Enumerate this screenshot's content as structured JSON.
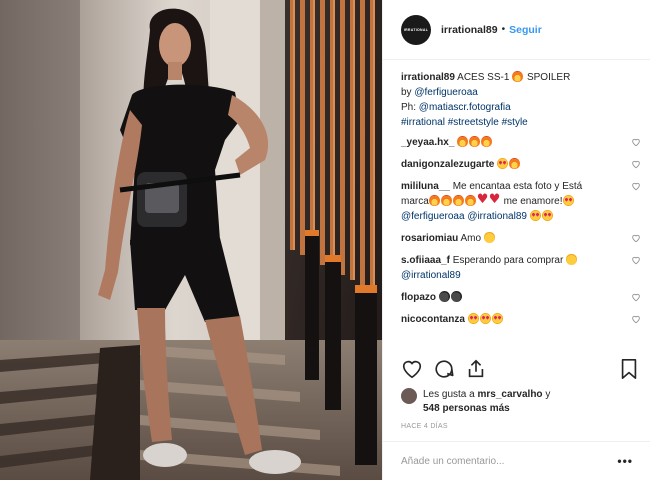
{
  "header": {
    "avatar_text": "IRRATIONAL",
    "username": "irrational89",
    "separator": "•",
    "follow_label": "Seguir"
  },
  "caption": {
    "username": "irrational89",
    "text1": "ACES SS-1",
    "text2": "SPOILER",
    "by_prefix": "by",
    "by_mention": "@ferfigueroaa",
    "ph_prefix": "Ph:",
    "ph_mention": "@matiascr.fotografia",
    "hashtags": [
      "#irrational",
      "#streetstyle",
      "#style"
    ]
  },
  "comments": [
    {
      "username": "_yeyaa.hx_",
      "emojis": [
        "fire",
        "fire",
        "fire"
      ]
    },
    {
      "username": "danigonzalezugarte",
      "emojis": [
        "love",
        "fire"
      ]
    },
    {
      "username": "mililuna__",
      "line1": "Me encantaa esta foto y Está",
      "line2_prefix": "marca",
      "line2_emojis_a": [
        "fire",
        "fire",
        "fire",
        "fire",
        "hrt",
        "hrt"
      ],
      "line2_text": "me enamore!",
      "line2_emojis_b": [
        "love"
      ],
      "mentions": [
        "@ferfigueroaa",
        "@irrational89"
      ],
      "line3_emojis": [
        "love",
        "love"
      ]
    },
    {
      "username": "rosariomiau",
      "text": "Amo",
      "emojis": [
        "cat"
      ]
    },
    {
      "username": "s.ofiiaaa_f",
      "text": "Esperando para comprar",
      "emojis": [
        "cat"
      ],
      "mention": "@irrational89"
    },
    {
      "username": "flopazo",
      "emojis": [
        "bomb",
        "bomb"
      ]
    },
    {
      "username": "nicocontanza",
      "emojis": [
        "love",
        "love",
        "love"
      ]
    }
  ],
  "likes": {
    "prefix": "Les gusta a",
    "user": "mrs_carvalho",
    "suffix": "y",
    "others": "548 personas más"
  },
  "timestamp": "HACE 4 DÍAS",
  "add_comment": {
    "placeholder": "Añade un comentario...",
    "more_label": "•••"
  },
  "colors": {
    "accent": "#3897f0",
    "link": "#003569",
    "text": "#262626",
    "muted": "#999999"
  }
}
